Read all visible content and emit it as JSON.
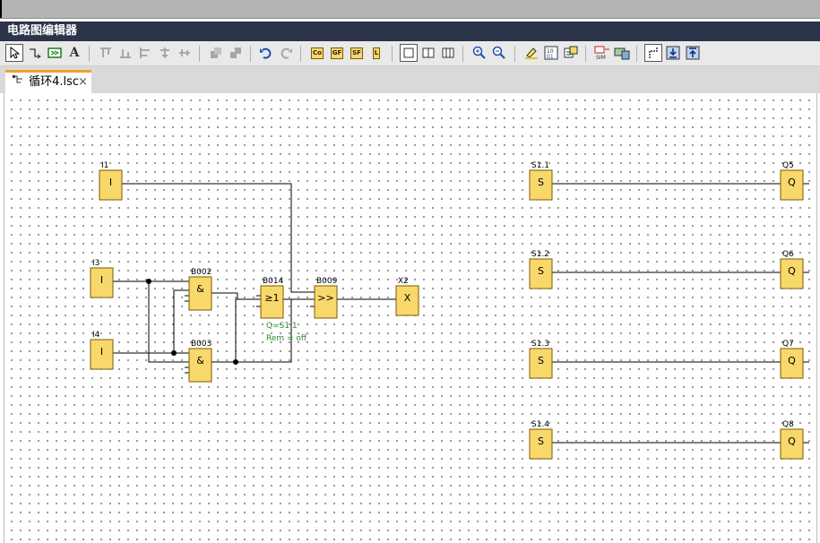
{
  "window": {
    "title": "电路图编辑器"
  },
  "tabs": [
    {
      "label": "循环4.lsc",
      "close": "×"
    }
  ],
  "toolbar": {
    "left_items": [
      "pointer-icon",
      "connect-icon",
      "blocks-icon",
      "text-icon"
    ],
    "co_label": "Co",
    "gf_label": "GF",
    "sf_label": "SF",
    "l_label": "L",
    "text_glyph": "A"
  },
  "diagram": {
    "blocks": [
      {
        "id": "I1",
        "label": "I1",
        "symbol": "I"
      },
      {
        "id": "I3",
        "label": "I3",
        "symbol": "I"
      },
      {
        "id": "I4",
        "label": "I4",
        "symbol": "I"
      },
      {
        "id": "B002",
        "label": "B002",
        "symbol": "&"
      },
      {
        "id": "B003",
        "label": "B003",
        "symbol": "&"
      },
      {
        "id": "B014",
        "label": "B014",
        "symbol": "≥1"
      },
      {
        "id": "B009",
        "label": "B009",
        "symbol": ">>"
      },
      {
        "id": "X2",
        "label": "X2",
        "symbol": "X"
      },
      {
        "id": "S1.1",
        "label": "S1.1",
        "symbol": "S"
      },
      {
        "id": "S1.2",
        "label": "S1.2",
        "symbol": "S"
      },
      {
        "id": "S1.3",
        "label": "S1.3",
        "symbol": "S"
      },
      {
        "id": "S1.4",
        "label": "S1.4",
        "symbol": "S"
      },
      {
        "id": "Q5",
        "label": "Q5",
        "symbol": "Q"
      },
      {
        "id": "Q6",
        "label": "Q6",
        "symbol": "Q"
      },
      {
        "id": "Q7",
        "label": "Q7",
        "symbol": "Q"
      },
      {
        "id": "Q8",
        "label": "Q8",
        "symbol": "Q"
      }
    ],
    "b009_params": {
      "q": "Q=S1.1",
      "rem": "Rem = off"
    },
    "colors": {
      "block_fill": "#f9d86b",
      "block_stroke": "#7a5a00",
      "wire": "#000000",
      "param_text": "#2e8b2e"
    }
  }
}
